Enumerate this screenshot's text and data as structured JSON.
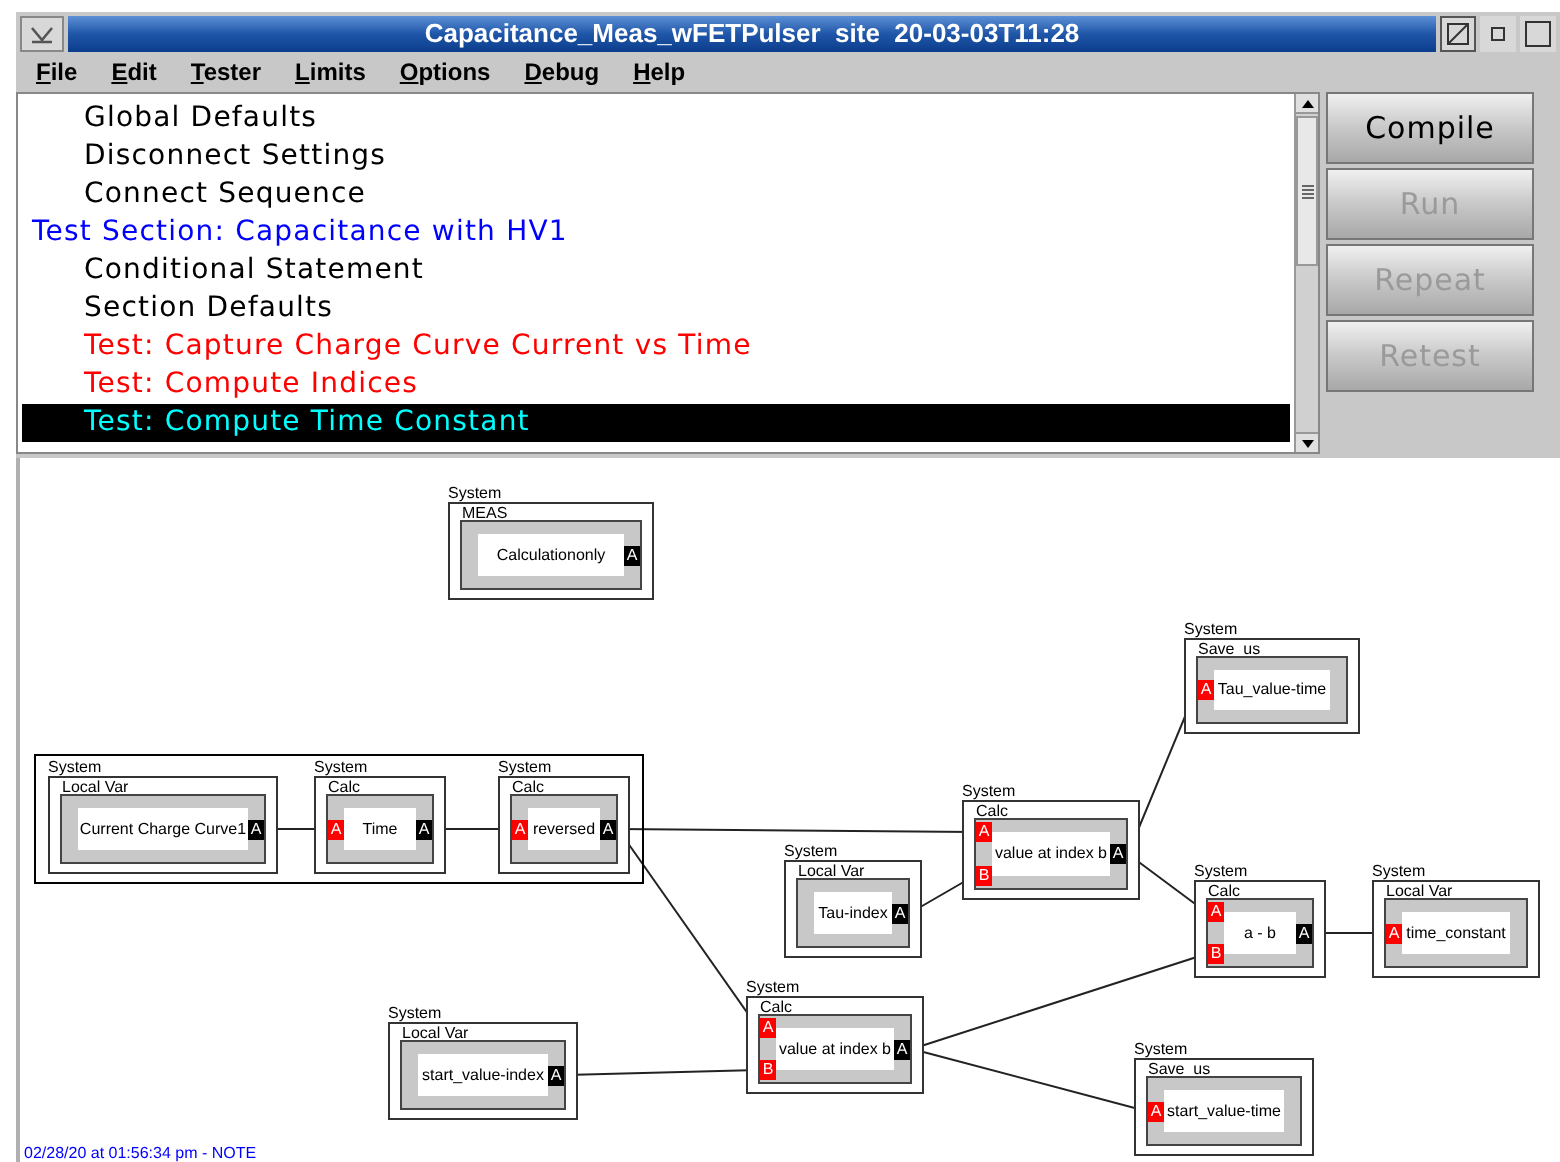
{
  "window": {
    "title": "Capacitance_Meas_wFETPulser  site  20-03-03T11:28"
  },
  "menu": [
    "File",
    "Edit",
    "Tester",
    "Limits",
    "Options",
    "Debug",
    "Help"
  ],
  "sequence": [
    {
      "label": "Global Defaults",
      "kind": "item",
      "selected": false
    },
    {
      "label": "Disconnect Settings",
      "kind": "item",
      "selected": false
    },
    {
      "label": "Connect Sequence",
      "kind": "item",
      "selected": false
    },
    {
      "label": "Test Section: Capacitance with HV1",
      "kind": "section",
      "selected": false
    },
    {
      "label": "Conditional Statement",
      "kind": "item",
      "selected": false
    },
    {
      "label": "Section Defaults",
      "kind": "item",
      "selected": false
    },
    {
      "label": "Test: Capture Charge Curve Current vs Time",
      "kind": "test",
      "selected": false
    },
    {
      "label": "Test: Compute Indices",
      "kind": "test",
      "selected": false
    },
    {
      "label": "Test: Compute Time Constant",
      "kind": "test",
      "selected": true
    }
  ],
  "buttons": [
    {
      "label": "Compile",
      "disabled": false
    },
    {
      "label": "Run",
      "disabled": true
    },
    {
      "label": "Repeat",
      "disabled": true
    },
    {
      "label": "Retest",
      "disabled": true
    }
  ],
  "nodes": [
    {
      "system": "System",
      "category": "MEAS",
      "label": "Calculationonly",
      "output": "A"
    },
    {
      "system": "System",
      "category": "Local Var",
      "label": "Current Charge Curve1",
      "output": "A"
    },
    {
      "system": "System",
      "category": "Calc",
      "label": "Time",
      "inputs": [
        "A"
      ],
      "output": "A"
    },
    {
      "system": "System",
      "category": "Calc",
      "label": "reversed",
      "inputs": [
        "A"
      ],
      "output": "A"
    },
    {
      "system": "System",
      "category": "Save_us",
      "label": "Tau_value-time",
      "inputs": [
        "A"
      ]
    },
    {
      "system": "System",
      "category": "Calc",
      "label": "value at index b",
      "inputs": [
        "A",
        "B"
      ],
      "output": "A"
    },
    {
      "system": "System",
      "category": "Local Var",
      "label": "Tau-index",
      "output": "A"
    },
    {
      "system": "System",
      "category": "Calc",
      "label": "a - b",
      "inputs": [
        "A",
        "B"
      ],
      "output": "A"
    },
    {
      "system": "System",
      "category": "Local Var",
      "label": "time_constant",
      "inputs": [
        "A"
      ]
    },
    {
      "system": "System",
      "category": "Local Var",
      "label": "start_value-index",
      "output": "A"
    },
    {
      "system": "System",
      "category": "Calc",
      "label": "value at index b",
      "inputs": [
        "A",
        "B"
      ],
      "output": "A"
    },
    {
      "system": "System",
      "category": "Save_us",
      "label": "start_value-time",
      "inputs": [
        "A"
      ]
    }
  ],
  "status": "02/28/20 at 01:56:34 pm - NOTE"
}
